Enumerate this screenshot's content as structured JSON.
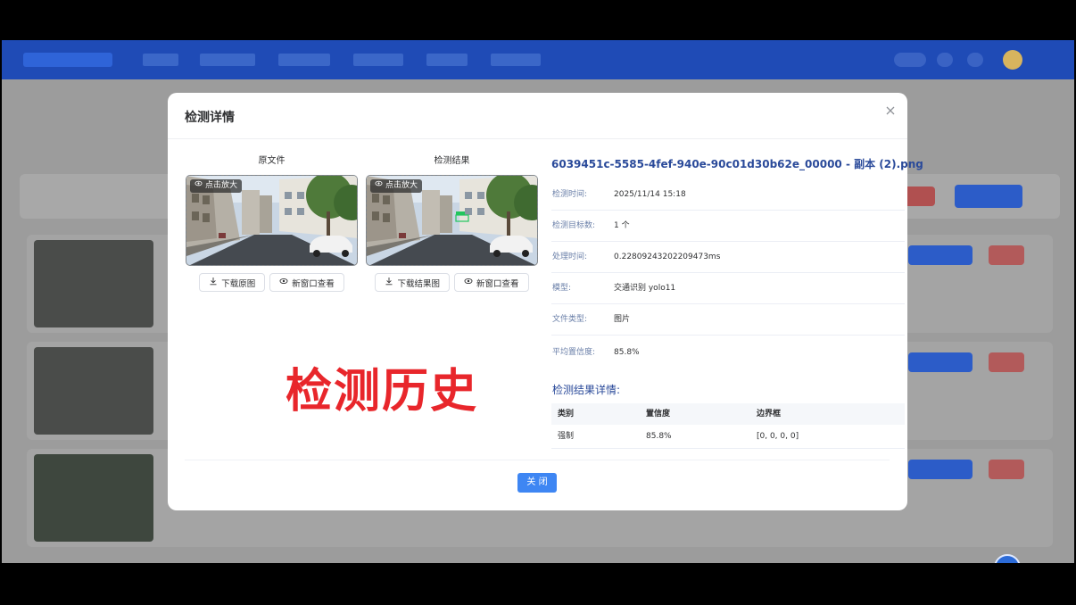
{
  "modal": {
    "title": "检测详情",
    "close_label": "关 闭"
  },
  "original": {
    "label": "原文件",
    "zoom_tag": "点击放大",
    "download_label": "下载原图",
    "open_label": "新窗口查看"
  },
  "result": {
    "label": "检测结果",
    "zoom_tag": "点击放大",
    "download_label": "下载结果图",
    "open_label": "新窗口查看"
  },
  "detail": {
    "file_name": "6039451c-5585-4fef-940e-90c01d30b62e_00000 - 副本 (2).png",
    "rows": [
      {
        "label": "检测时间:",
        "value": "2025/11/14 15:18"
      },
      {
        "label": "检测目标数:",
        "value": "1 个"
      },
      {
        "label": "处理时间:",
        "value": "0.22809243202209473ms"
      },
      {
        "label": "模型:",
        "value": "交通识别 yolo11"
      },
      {
        "label": "文件类型:",
        "value": "图片"
      },
      {
        "label": "平均置信度:",
        "value": "85.8%"
      }
    ],
    "results_title": "检测结果详情:",
    "table": {
      "headers": [
        "类别",
        "置信度",
        "边界框"
      ],
      "rows": [
        [
          "强制",
          "85.8%",
          "[0, 0, 0, 0]"
        ]
      ]
    }
  },
  "watermark": "检测历史",
  "colors": {
    "nav": "#1f4bb6",
    "primary": "#3e86f3",
    "watermark": "#e8262b",
    "link": "#2a4a9a"
  }
}
